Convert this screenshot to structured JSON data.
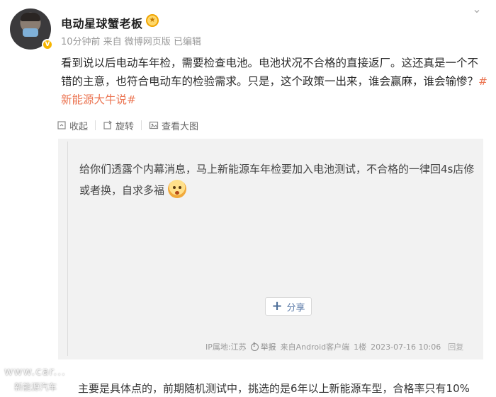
{
  "post": {
    "author": "电动星球蟹老板",
    "meta": "10分钟前 来自 微博网页版 已编辑",
    "body_text": "看到说以后电动车年检，需要检查电池。电池状况不合格的直接返厂。这还真是一个不错的主意，也符合电动车的检验需求。只是，这个政策一出来，谁会赢麻，谁会输惨？",
    "hashtag": "#新能源大牛说#",
    "verified_badge": "V"
  },
  "toolbar": {
    "collapse_label": "收起",
    "rotate_label": "旋转",
    "view_large_label": "查看大图"
  },
  "quoted": {
    "text": "给你们透露个内幕消息，马上新能源车年检要加入电池测试，不合格的一律回4s店修或者换，自求多福",
    "share_label": "分享",
    "footer": {
      "ip": "IP属地:江苏",
      "report": "举报",
      "source": "来自Android客户端",
      "floor": "1楼",
      "time": "2023-07-16 10:06",
      "reply": "回复"
    }
  },
  "bottom_text": "主要是具体点的，前期随机测试中，挑选的是6年以上新能源车型，合格率只有10%",
  "watermark": {
    "line1": "www.car...",
    "line2": "新能源汽车"
  },
  "colors": {
    "hashtag": "#eb7350",
    "verified": "#f7b500",
    "share_text": "#5a7aa8"
  },
  "icons": [
    "more-icon",
    "collapse-icon",
    "rotate-icon",
    "view-large-icon",
    "plus-icon",
    "report-icon"
  ]
}
